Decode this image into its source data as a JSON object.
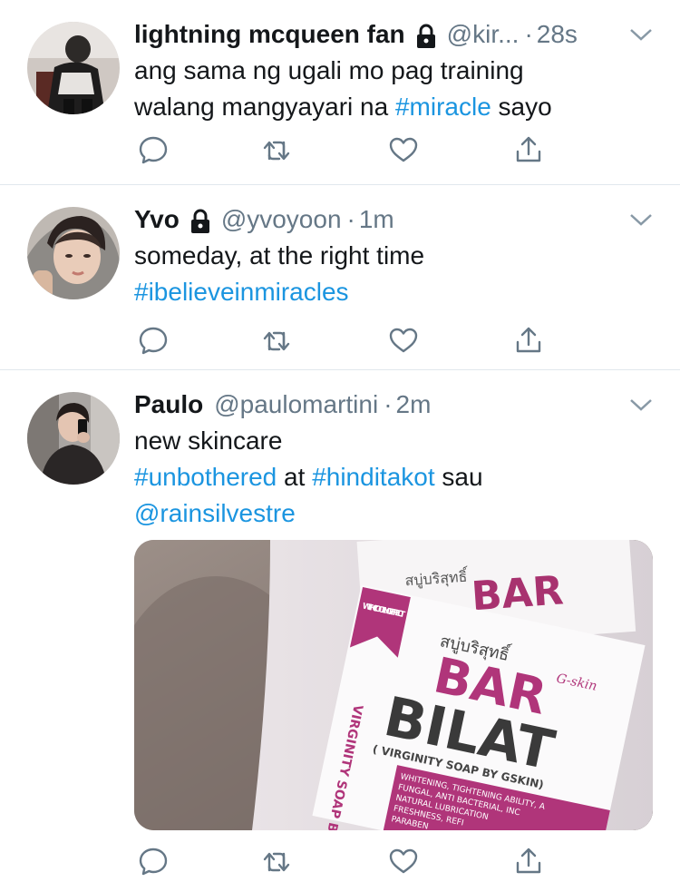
{
  "tweets": [
    {
      "name": "lightning mcqueen fan",
      "handle": "@kir...",
      "sep": "·",
      "time": "28s",
      "protected": true,
      "lines": [
        [
          {
            "t": "ang sama ng ugali mo pag training"
          }
        ],
        [
          {
            "t": "walang mangyayari na "
          },
          {
            "t": "#miracle",
            "tag": true
          },
          {
            "t": " sayo"
          }
        ]
      ]
    },
    {
      "name": "Yvo",
      "handle": "@yvoyoon",
      "sep": "·",
      "time": "1m",
      "protected": true,
      "lines": [
        [
          {
            "t": "someday, at the right time"
          }
        ],
        [
          {
            "t": "#ibelieveinmiracles",
            "tag": true
          }
        ]
      ]
    },
    {
      "name": "Paulo",
      "handle": "@paulomartini",
      "sep": "·",
      "time": "2m",
      "protected": false,
      "lines": [
        [
          {
            "t": "new skincare"
          }
        ],
        [
          {
            "t": "#unbothered",
            "tag": true
          },
          {
            "t": " at "
          },
          {
            "t": "#hinditakot",
            "tag": true
          },
          {
            "t": " sau"
          }
        ],
        [
          {
            "t": "@rainsilvestre",
            "tag": true
          }
        ]
      ],
      "media": {
        "badge": "WITH COOLING EFFECT",
        "thai": "สบู่บริสุทธิ์",
        "line1": "BAR",
        "line2": "BILAT",
        "sub": "( VIRGINITY SOAP BY GSKIN)",
        "brand": "G-skin",
        "side": "VIRGINITY SOAP BY G",
        "desc1": "WHITENING, TIGHTENING ABILITY, A",
        "desc2": "FUNGAL, ANTI BACTERIAL, INC",
        "desc3": "NATURAL LUBRICATION",
        "desc4": "FRESHNESS, REFI",
        "desc5": "PARABEN"
      }
    }
  ],
  "icons": [
    "reply-icon",
    "retweet-icon",
    "like-icon",
    "share-icon",
    "caret-down-icon",
    "lock-icon"
  ],
  "colors": {
    "link": "#1b95e0",
    "muted": "#657786",
    "divider": "#e1e8ed",
    "brand_pink": "#b0357a"
  }
}
